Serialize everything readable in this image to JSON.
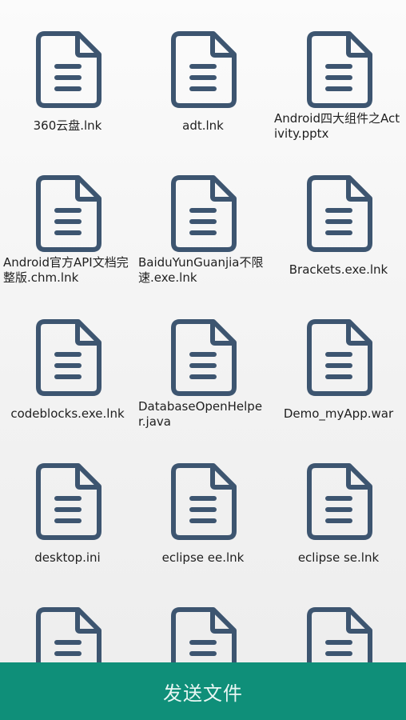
{
  "files": [
    {
      "name": "360云盘.lnk"
    },
    {
      "name": "adt.lnk"
    },
    {
      "name": "Android四大组件之Activity.pptx"
    },
    {
      "name": "Android官方API文档完整版.chm.lnk"
    },
    {
      "name": "BaiduYunGuanjia不限速.exe.lnk"
    },
    {
      "name": "Brackets.exe.lnk"
    },
    {
      "name": "codeblocks.exe.lnk"
    },
    {
      "name": "DatabaseOpenHelper.java"
    },
    {
      "name": "Demo_myApp.war"
    },
    {
      "name": "desktop.ini"
    },
    {
      "name": "eclipse ee.lnk"
    },
    {
      "name": "eclipse se.lnk"
    },
    {
      "name": ""
    },
    {
      "name": ""
    },
    {
      "name": ""
    }
  ],
  "send_button": {
    "label": "发送文件"
  },
  "colors": {
    "icon": "#3d5570",
    "accent": "#0f8f79"
  },
  "icons": {
    "file": "document-icon"
  }
}
